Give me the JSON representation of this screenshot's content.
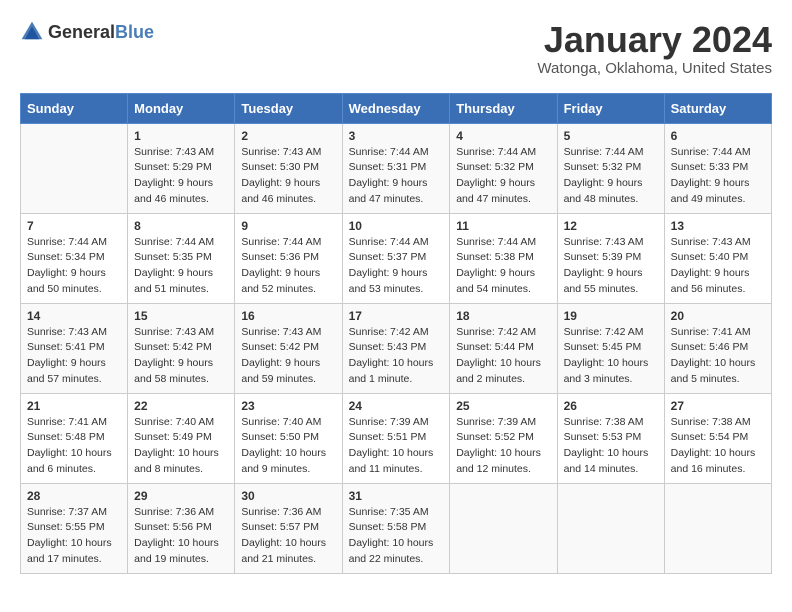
{
  "logo": {
    "general": "General",
    "blue": "Blue"
  },
  "header": {
    "title": "January 2024",
    "subtitle": "Watonga, Oklahoma, United States"
  },
  "days_of_week": [
    "Sunday",
    "Monday",
    "Tuesday",
    "Wednesday",
    "Thursday",
    "Friday",
    "Saturday"
  ],
  "weeks": [
    [
      {
        "day": "",
        "info": ""
      },
      {
        "day": "1",
        "info": "Sunrise: 7:43 AM\nSunset: 5:29 PM\nDaylight: 9 hours\nand 46 minutes."
      },
      {
        "day": "2",
        "info": "Sunrise: 7:43 AM\nSunset: 5:30 PM\nDaylight: 9 hours\nand 46 minutes."
      },
      {
        "day": "3",
        "info": "Sunrise: 7:44 AM\nSunset: 5:31 PM\nDaylight: 9 hours\nand 47 minutes."
      },
      {
        "day": "4",
        "info": "Sunrise: 7:44 AM\nSunset: 5:32 PM\nDaylight: 9 hours\nand 47 minutes."
      },
      {
        "day": "5",
        "info": "Sunrise: 7:44 AM\nSunset: 5:32 PM\nDaylight: 9 hours\nand 48 minutes."
      },
      {
        "day": "6",
        "info": "Sunrise: 7:44 AM\nSunset: 5:33 PM\nDaylight: 9 hours\nand 49 minutes."
      }
    ],
    [
      {
        "day": "7",
        "info": "Sunrise: 7:44 AM\nSunset: 5:34 PM\nDaylight: 9 hours\nand 50 minutes."
      },
      {
        "day": "8",
        "info": "Sunrise: 7:44 AM\nSunset: 5:35 PM\nDaylight: 9 hours\nand 51 minutes."
      },
      {
        "day": "9",
        "info": "Sunrise: 7:44 AM\nSunset: 5:36 PM\nDaylight: 9 hours\nand 52 minutes."
      },
      {
        "day": "10",
        "info": "Sunrise: 7:44 AM\nSunset: 5:37 PM\nDaylight: 9 hours\nand 53 minutes."
      },
      {
        "day": "11",
        "info": "Sunrise: 7:44 AM\nSunset: 5:38 PM\nDaylight: 9 hours\nand 54 minutes."
      },
      {
        "day": "12",
        "info": "Sunrise: 7:43 AM\nSunset: 5:39 PM\nDaylight: 9 hours\nand 55 minutes."
      },
      {
        "day": "13",
        "info": "Sunrise: 7:43 AM\nSunset: 5:40 PM\nDaylight: 9 hours\nand 56 minutes."
      }
    ],
    [
      {
        "day": "14",
        "info": "Sunrise: 7:43 AM\nSunset: 5:41 PM\nDaylight: 9 hours\nand 57 minutes."
      },
      {
        "day": "15",
        "info": "Sunrise: 7:43 AM\nSunset: 5:42 PM\nDaylight: 9 hours\nand 58 minutes."
      },
      {
        "day": "16",
        "info": "Sunrise: 7:43 AM\nSunset: 5:42 PM\nDaylight: 9 hours\nand 59 minutes."
      },
      {
        "day": "17",
        "info": "Sunrise: 7:42 AM\nSunset: 5:43 PM\nDaylight: 10 hours\nand 1 minute."
      },
      {
        "day": "18",
        "info": "Sunrise: 7:42 AM\nSunset: 5:44 PM\nDaylight: 10 hours\nand 2 minutes."
      },
      {
        "day": "19",
        "info": "Sunrise: 7:42 AM\nSunset: 5:45 PM\nDaylight: 10 hours\nand 3 minutes."
      },
      {
        "day": "20",
        "info": "Sunrise: 7:41 AM\nSunset: 5:46 PM\nDaylight: 10 hours\nand 5 minutes."
      }
    ],
    [
      {
        "day": "21",
        "info": "Sunrise: 7:41 AM\nSunset: 5:48 PM\nDaylight: 10 hours\nand 6 minutes."
      },
      {
        "day": "22",
        "info": "Sunrise: 7:40 AM\nSunset: 5:49 PM\nDaylight: 10 hours\nand 8 minutes."
      },
      {
        "day": "23",
        "info": "Sunrise: 7:40 AM\nSunset: 5:50 PM\nDaylight: 10 hours\nand 9 minutes."
      },
      {
        "day": "24",
        "info": "Sunrise: 7:39 AM\nSunset: 5:51 PM\nDaylight: 10 hours\nand 11 minutes."
      },
      {
        "day": "25",
        "info": "Sunrise: 7:39 AM\nSunset: 5:52 PM\nDaylight: 10 hours\nand 12 minutes."
      },
      {
        "day": "26",
        "info": "Sunrise: 7:38 AM\nSunset: 5:53 PM\nDaylight: 10 hours\nand 14 minutes."
      },
      {
        "day": "27",
        "info": "Sunrise: 7:38 AM\nSunset: 5:54 PM\nDaylight: 10 hours\nand 16 minutes."
      }
    ],
    [
      {
        "day": "28",
        "info": "Sunrise: 7:37 AM\nSunset: 5:55 PM\nDaylight: 10 hours\nand 17 minutes."
      },
      {
        "day": "29",
        "info": "Sunrise: 7:36 AM\nSunset: 5:56 PM\nDaylight: 10 hours\nand 19 minutes."
      },
      {
        "day": "30",
        "info": "Sunrise: 7:36 AM\nSunset: 5:57 PM\nDaylight: 10 hours\nand 21 minutes."
      },
      {
        "day": "31",
        "info": "Sunrise: 7:35 AM\nSunset: 5:58 PM\nDaylight: 10 hours\nand 22 minutes."
      },
      {
        "day": "",
        "info": ""
      },
      {
        "day": "",
        "info": ""
      },
      {
        "day": "",
        "info": ""
      }
    ]
  ]
}
